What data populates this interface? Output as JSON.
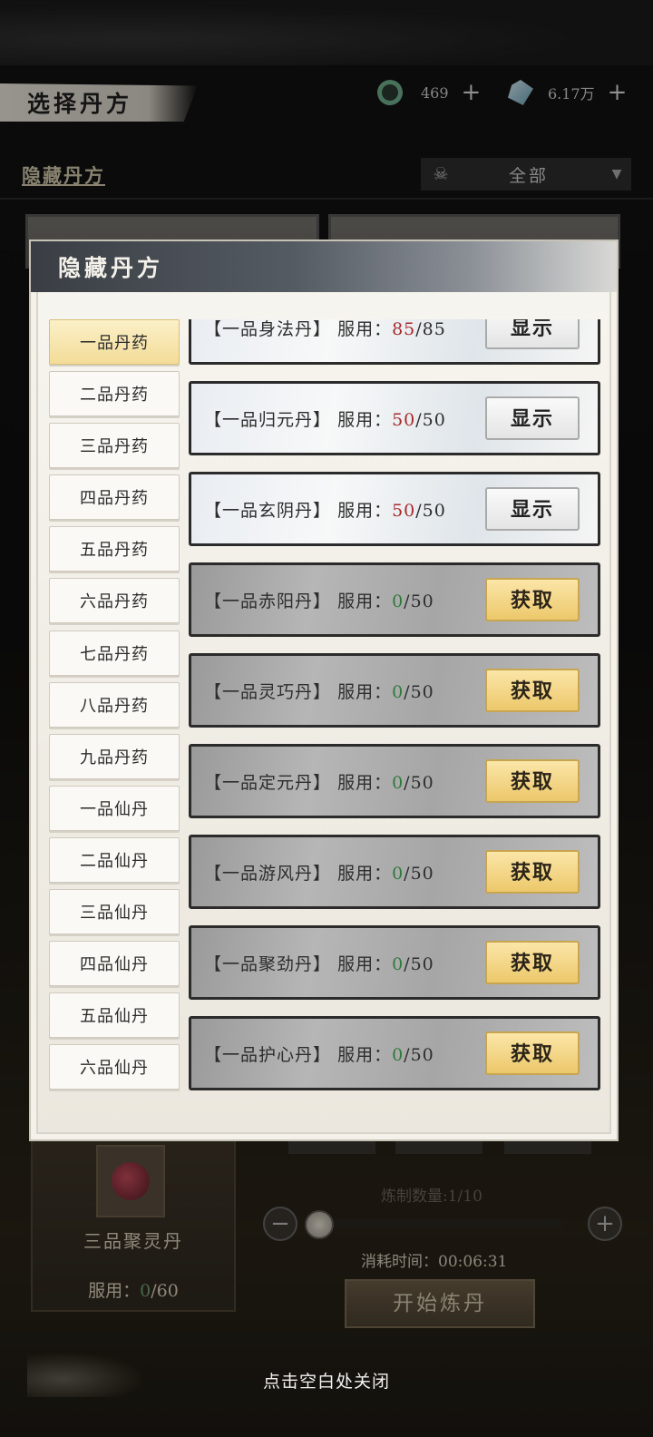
{
  "screen": {
    "title": "选择丹方",
    "resources": [
      {
        "icon": "jade-coin-icon",
        "value": "469"
      },
      {
        "icon": "crystal-icon",
        "value": "6.17万"
      }
    ],
    "hidden_recipes_link": "隐藏丹方",
    "filter": {
      "icon": "skull-icon",
      "value": "全部"
    }
  },
  "background_card": {
    "name": "三品聚灵丹",
    "take_label": "服用：",
    "take_current": "0",
    "take_sep": "/",
    "take_max": "60"
  },
  "crafting": {
    "count_label": "炼制数量:1/10",
    "time_label": "消耗时间：00:06:31",
    "start_button": "开始炼丹"
  },
  "modal": {
    "title": "隐藏丹方",
    "categories": [
      {
        "label": "一品丹药",
        "active": true
      },
      {
        "label": "二品丹药"
      },
      {
        "label": "三品丹药"
      },
      {
        "label": "四品丹药"
      },
      {
        "label": "五品丹药"
      },
      {
        "label": "六品丹药"
      },
      {
        "label": "七品丹药"
      },
      {
        "label": "八品丹药"
      },
      {
        "label": "九品丹药"
      },
      {
        "label": "一品仙丹"
      },
      {
        "label": "二品仙丹"
      },
      {
        "label": "三品仙丹"
      },
      {
        "label": "四品仙丹"
      },
      {
        "label": "五品仙丹"
      },
      {
        "label": "六品仙丹"
      }
    ],
    "pills": [
      {
        "name": "【一品身法丹】",
        "label": "服用：",
        "current": "85",
        "max": "85",
        "state": "owned",
        "button": "显示"
      },
      {
        "name": "【一品归元丹】",
        "label": "服用：",
        "current": "50",
        "max": "50",
        "state": "owned",
        "button": "显示"
      },
      {
        "name": "【一品玄阴丹】",
        "label": "服用：",
        "current": "50",
        "max": "50",
        "state": "owned",
        "button": "显示"
      },
      {
        "name": "【一品赤阳丹】",
        "label": "服用：",
        "current": "0",
        "max": "50",
        "state": "locked",
        "button": "获取"
      },
      {
        "name": "【一品灵巧丹】",
        "label": "服用：",
        "current": "0",
        "max": "50",
        "state": "locked",
        "button": "获取"
      },
      {
        "name": "【一品定元丹】",
        "label": "服用：",
        "current": "0",
        "max": "50",
        "state": "locked",
        "button": "获取"
      },
      {
        "name": "【一品游风丹】",
        "label": "服用：",
        "current": "0",
        "max": "50",
        "state": "locked",
        "button": "获取"
      },
      {
        "name": "【一品聚劲丹】",
        "label": "服用：",
        "current": "0",
        "max": "50",
        "state": "locked",
        "button": "获取"
      },
      {
        "name": "【一品护心丹】",
        "label": "服用：",
        "current": "0",
        "max": "50",
        "state": "locked",
        "button": "获取"
      }
    ]
  },
  "close_hint": "点击空白处关闭"
}
